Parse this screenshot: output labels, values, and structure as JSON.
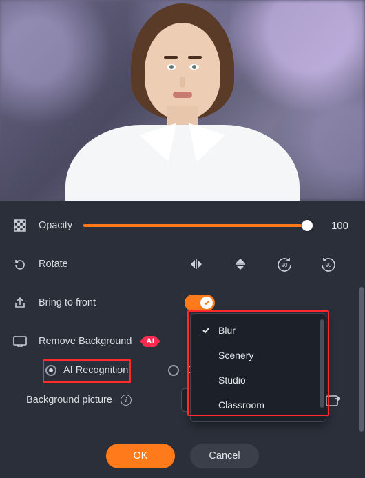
{
  "opacity": {
    "label": "Opacity",
    "value": "100",
    "percent": 100
  },
  "rotate": {
    "label": "Rotate"
  },
  "bring_to_front": {
    "label": "Bring to front",
    "on": true
  },
  "remove_bg": {
    "label": "Remove Background",
    "badge": "AI"
  },
  "radios": {
    "ai": "AI Recognition",
    "green": "Green"
  },
  "bg_picture": {
    "label": "Background picture",
    "selected": "Blur"
  },
  "dropdown": {
    "items": [
      "Blur",
      "Scenery",
      "Studio",
      "Classroom"
    ],
    "selected_index": 0
  },
  "buttons": {
    "ok": "OK",
    "cancel": "Cancel"
  }
}
